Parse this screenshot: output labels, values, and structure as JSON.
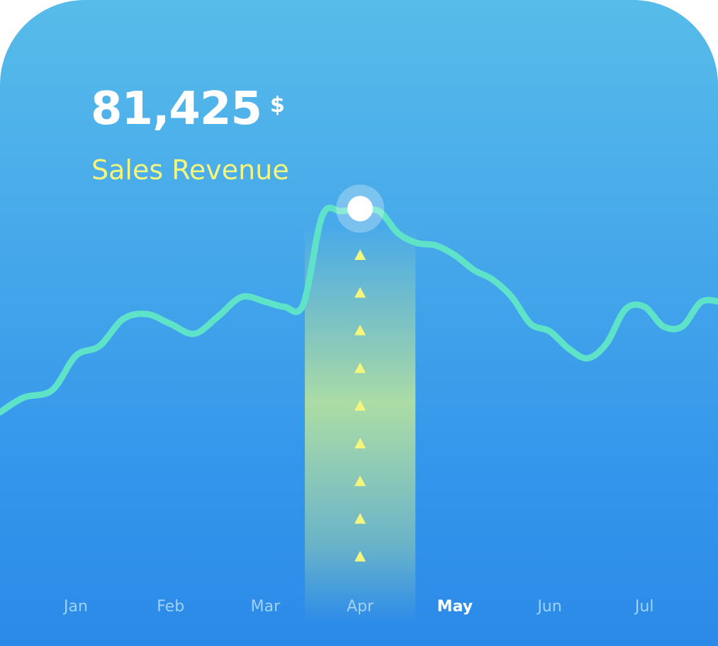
{
  "summary": {
    "value": "81,425",
    "currency": "$",
    "label": "Sales Revenue"
  },
  "colors": {
    "line": "#5fe3c8",
    "highlight_band": "#d8f58a",
    "marker_arrows": "#f4f57c",
    "active_month": "#ffffff",
    "month_label": "#9fd2f4"
  },
  "chart_data": {
    "type": "line",
    "title": "",
    "xlabel": "",
    "ylabel": "",
    "categories": [
      "Jan",
      "Feb",
      "Mar",
      "Apr",
      "May",
      "Jun",
      "Jul"
    ],
    "active_category": "May",
    "highlighted_category": "Apr",
    "grid": false,
    "y_axis_shown": false,
    "series": [
      {
        "x": [
          -0.8,
          -0.55,
          -0.25,
          0.0,
          0.25,
          0.5,
          0.75,
          1.0,
          1.25,
          1.5,
          1.75,
          2.0,
          2.2,
          2.4,
          2.6,
          2.8,
          3.0,
          3.2,
          3.4,
          3.6,
          3.8,
          4.0,
          4.2,
          4.4,
          4.6,
          4.8,
          5.0,
          5.2,
          5.4,
          5.6,
          5.8,
          6.0,
          6.2,
          6.4,
          6.6,
          6.8
        ],
        "values": [
          0.13,
          0.19,
          0.22,
          0.36,
          0.4,
          0.51,
          0.53,
          0.49,
          0.45,
          0.52,
          0.6,
          0.58,
          0.56,
          0.57,
          0.93,
          0.95,
          0.95,
          0.95,
          0.86,
          0.82,
          0.81,
          0.77,
          0.71,
          0.67,
          0.6,
          0.49,
          0.46,
          0.39,
          0.35,
          0.41,
          0.55,
          0.56,
          0.48,
          0.48,
          0.58,
          0.58
        ]
      }
    ],
    "highlight_point": {
      "x": 3.0,
      "y": 0.96
    }
  }
}
